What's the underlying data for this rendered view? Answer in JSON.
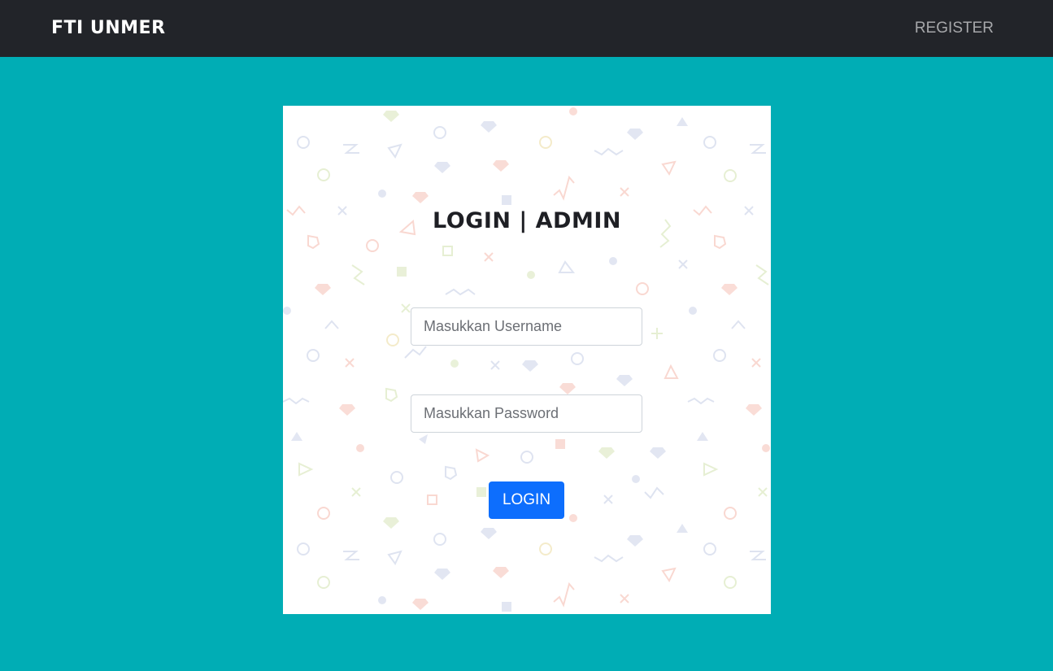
{
  "navbar": {
    "brand": "FTI UNMER",
    "register_link": "REGISTER"
  },
  "login_card": {
    "title": "LOGIN | ADMIN",
    "username_placeholder": "Masukkan Username",
    "username_value": "",
    "password_placeholder": "Masukkan Password",
    "password_value": "",
    "login_button": "LOGIN"
  },
  "colors": {
    "page_background": "#00adb5",
    "navbar_background": "#222429",
    "button_primary": "#0d6efd",
    "card_background": "#ffffff"
  },
  "icons": {
    "background_pattern": "memphis-confetti-pattern"
  }
}
